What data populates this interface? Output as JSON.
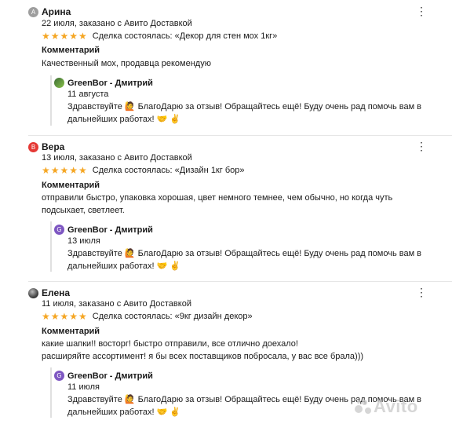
{
  "reviews": [
    {
      "avatar_letter": "А",
      "avatar_color": "#9e9e9e",
      "name": "Арина",
      "meta": "22 июля, заказано с Авито Доставкой",
      "stars": "★★★★★",
      "deal": "Сделка состоялась: «Декор для стен мох 1кг»",
      "comment_title": "Комментарий",
      "comment": "Качественный мох, продавца рекомендую",
      "reply": {
        "seller": "GreenBor - Дмитрий",
        "date": "11 августа",
        "text": "Здравствуйте 🙋 БлагоДарю за отзыв! Обращайтесь ещё! Буду очень рад помочь вам в дальнейших работах! 🤝 ✌"
      }
    },
    {
      "avatar_letter": "В",
      "avatar_color": "#e53935",
      "name": "Вера",
      "meta": "13 июля, заказано с Авито Доставкой",
      "stars": "★★★★★",
      "deal": "Сделка состоялась: «Дизайн 1кг бор»",
      "comment_title": "Комментарий",
      "comment": "отправили быстро, упаковка хорошая, цвет немного темнее, чем обычно, но когда чуть подсыхает, светлеет.",
      "reply": {
        "avatar_letter": "G",
        "seller": "GreenBor - Дмитрий",
        "date": "13 июля",
        "text": "Здравствуйте 🙋 БлагоДарю за отзыв! Обращайтесь ещё! Буду очень рад помочь вам в дальнейших работах! 🤝 ✌"
      }
    },
    {
      "avatar_letter": "",
      "avatar_color": "#555555",
      "name": "Елена",
      "meta": "11 июля, заказано с Авито Доставкой",
      "stars": "★★★★★",
      "deal": "Сделка состоялась: «9кг дизайн декор»",
      "comment_title": "Комментарий",
      "comment_lines": [
        "какие шапки!! восторг! быстро отправили, все отлично доехало!",
        "расширяйте ассортимент! я бы всех поставщиков побросала, у вас все брала)))"
      ],
      "reply": {
        "avatar_letter": "G",
        "seller": "GreenBor - Дмитрий",
        "date": "11 июля",
        "text": "Здравствуйте 🙋 БлагоДарю за отзыв! Обращайтесь ещё! Буду очень рад помочь вам в дальнейших работах! 🤝 ✌"
      }
    }
  ],
  "more_icon": "⋮",
  "watermark": "Avito",
  "colors": {
    "stars": "#f5a623",
    "seller_avatar": "#7e57c2"
  }
}
